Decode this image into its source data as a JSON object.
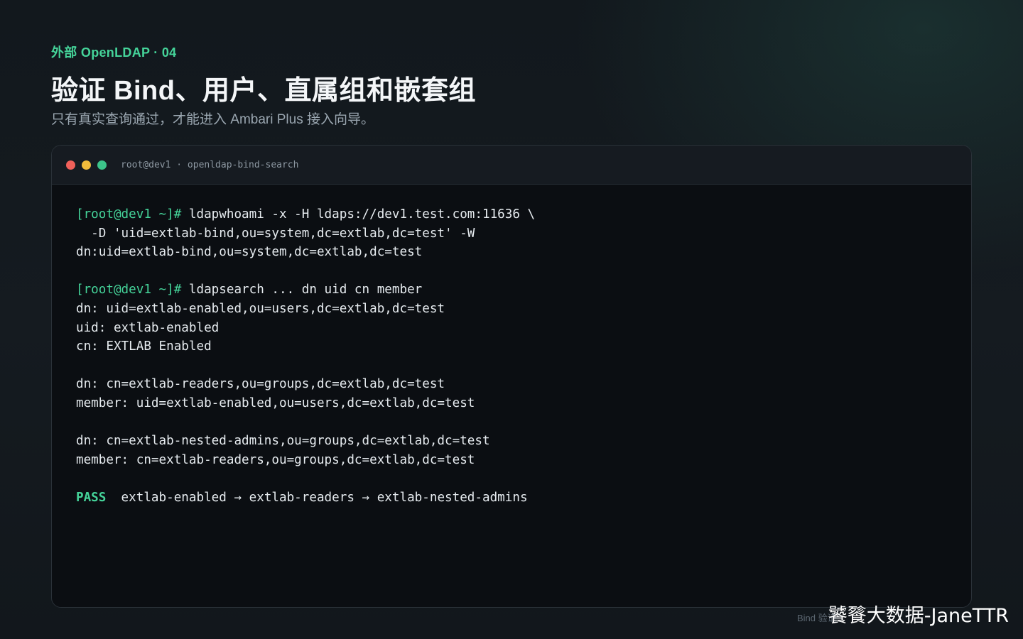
{
  "header": {
    "eyebrow": "外部 OpenLDAP · 04",
    "title": "验证 Bind、用户、直属组和嵌套组",
    "subtitle": "只有真实查询通过，才能进入 Ambari Plus 接入向导。"
  },
  "terminal": {
    "title": "root@dev1 · openldap-bind-search",
    "lines": {
      "l1_prompt": "[root@dev1 ~]#",
      "l1_cmd": " ldapwhoami -x -H ldaps://dev1.test.com:11636 \\",
      "l2": "  -D 'uid=extlab-bind,ou=system,dc=extlab,dc=test' -W",
      "l3": "dn:uid=extlab-bind,ou=system,dc=extlab,dc=test",
      "l5_prompt": "[root@dev1 ~]#",
      "l5_cmd": " ldapsearch ... dn uid cn member",
      "l6": "dn: uid=extlab-enabled,ou=users,dc=extlab,dc=test",
      "l7": "uid: extlab-enabled",
      "l8": "cn: EXTLAB Enabled",
      "l10": "dn: cn=extlab-readers,ou=groups,dc=extlab,dc=test",
      "l11": "member: uid=extlab-enabled,ou=users,dc=extlab,dc=test",
      "l13": "dn: cn=extlab-nested-admins,ou=groups,dc=extlab,dc=test",
      "l14": "member: cn=extlab-readers,ou=groups,dc=extlab,dc=test",
      "l16_status": "PASS",
      "l16_text": "  extlab-enabled → extlab-readers → extlab-nested-admins"
    }
  },
  "footer": {
    "note": "Bind 验证",
    "watermark": "饕餮大数据-JaneTTR"
  },
  "colors": {
    "accent": "#45d49a",
    "terminal_bg": "#0b0e12",
    "dot_red": "#f0605a",
    "dot_yellow": "#f3bd3c",
    "dot_green": "#3cc48a"
  }
}
